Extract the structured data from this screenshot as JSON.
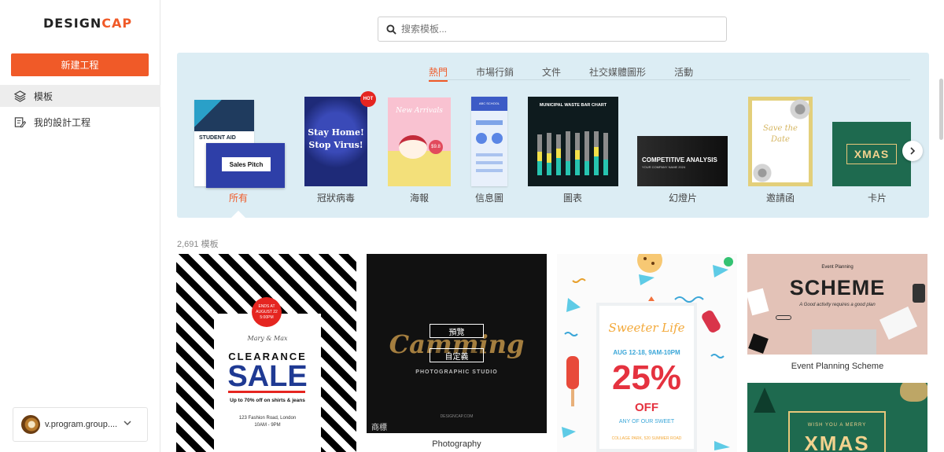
{
  "sidebar": {
    "logo_a": "DESIGN",
    "logo_b": "CAP",
    "new_project": "新建工程",
    "items": [
      {
        "label": "模板",
        "icon": "layers-icon"
      },
      {
        "label": "我的設計工程",
        "icon": "edit-document-icon"
      }
    ],
    "account": "v.program.group...."
  },
  "search": {
    "placeholder": "搜索模板..."
  },
  "category_tabs": [
    "熱門",
    "市場行銷",
    "文件",
    "社交媒體圖形",
    "活動"
  ],
  "categories": [
    {
      "label": "所有",
      "thumb_a": "STUDENT AID",
      "thumb_b": "Sales Pitch"
    },
    {
      "label": "冠狀病毒",
      "thumb": "Stay Home! Stop Virus!",
      "badge": "HOT"
    },
    {
      "label": "海報",
      "thumb": "New Arrivals",
      "price": "$9.8"
    },
    {
      "label": "信息圖",
      "thumb": "ABC SCHOOL"
    },
    {
      "label": "圖表",
      "thumb": "MUNICIPAL WASTE BAR CHART"
    },
    {
      "label": "幻燈片",
      "thumb": "COMPETITIVE ANALYSIS",
      "sub": "YOUR COMPANY NAME 2024"
    },
    {
      "label": "邀請函",
      "thumb_a": "Save the",
      "thumb_b": "Date"
    },
    {
      "label": "卡片",
      "thumb": "XMAS"
    }
  ],
  "count_label": "2,691 模板",
  "templates": [
    {
      "badge_a": "ENDS AT",
      "badge_b": "AUGUST 22",
      "badge_c": "5:00PM",
      "names": "Mary & Max",
      "title_a": "CLEARANCE",
      "title_b": "SALE",
      "offer": "Up to 70% off on shirts & jeans",
      "addr_a": "123 Fashion Road, London",
      "addr_b": "10AM - 9PM"
    },
    {
      "caption": "Photography",
      "script": "Camming",
      "studio": "PHOTOGRAPHIC STUDIO",
      "site": "DESIGNCAP.COM",
      "edit_btn": "預覽",
      "custom_btn": "自定義",
      "tag": "商標"
    },
    {
      "title": "Sweeter Life",
      "dates": "AUG 12-18, 9AM-10PM",
      "pct": "25%",
      "off": "OFF",
      "sub": "ANY OF OUR SWEET",
      "addr": "COLLAGE PARK, 520 SUMMER ROAD"
    },
    {
      "caption": "Event Planning Scheme",
      "top": "Event Planning",
      "title": "SCHEME",
      "sub": "A Good activity requires a good plan"
    },
    {
      "greeting": "WISH YOU A MERRY",
      "title": "XMAS"
    }
  ],
  "colors": {
    "accent": "#f05a28",
    "panel": "#dcedf4"
  }
}
